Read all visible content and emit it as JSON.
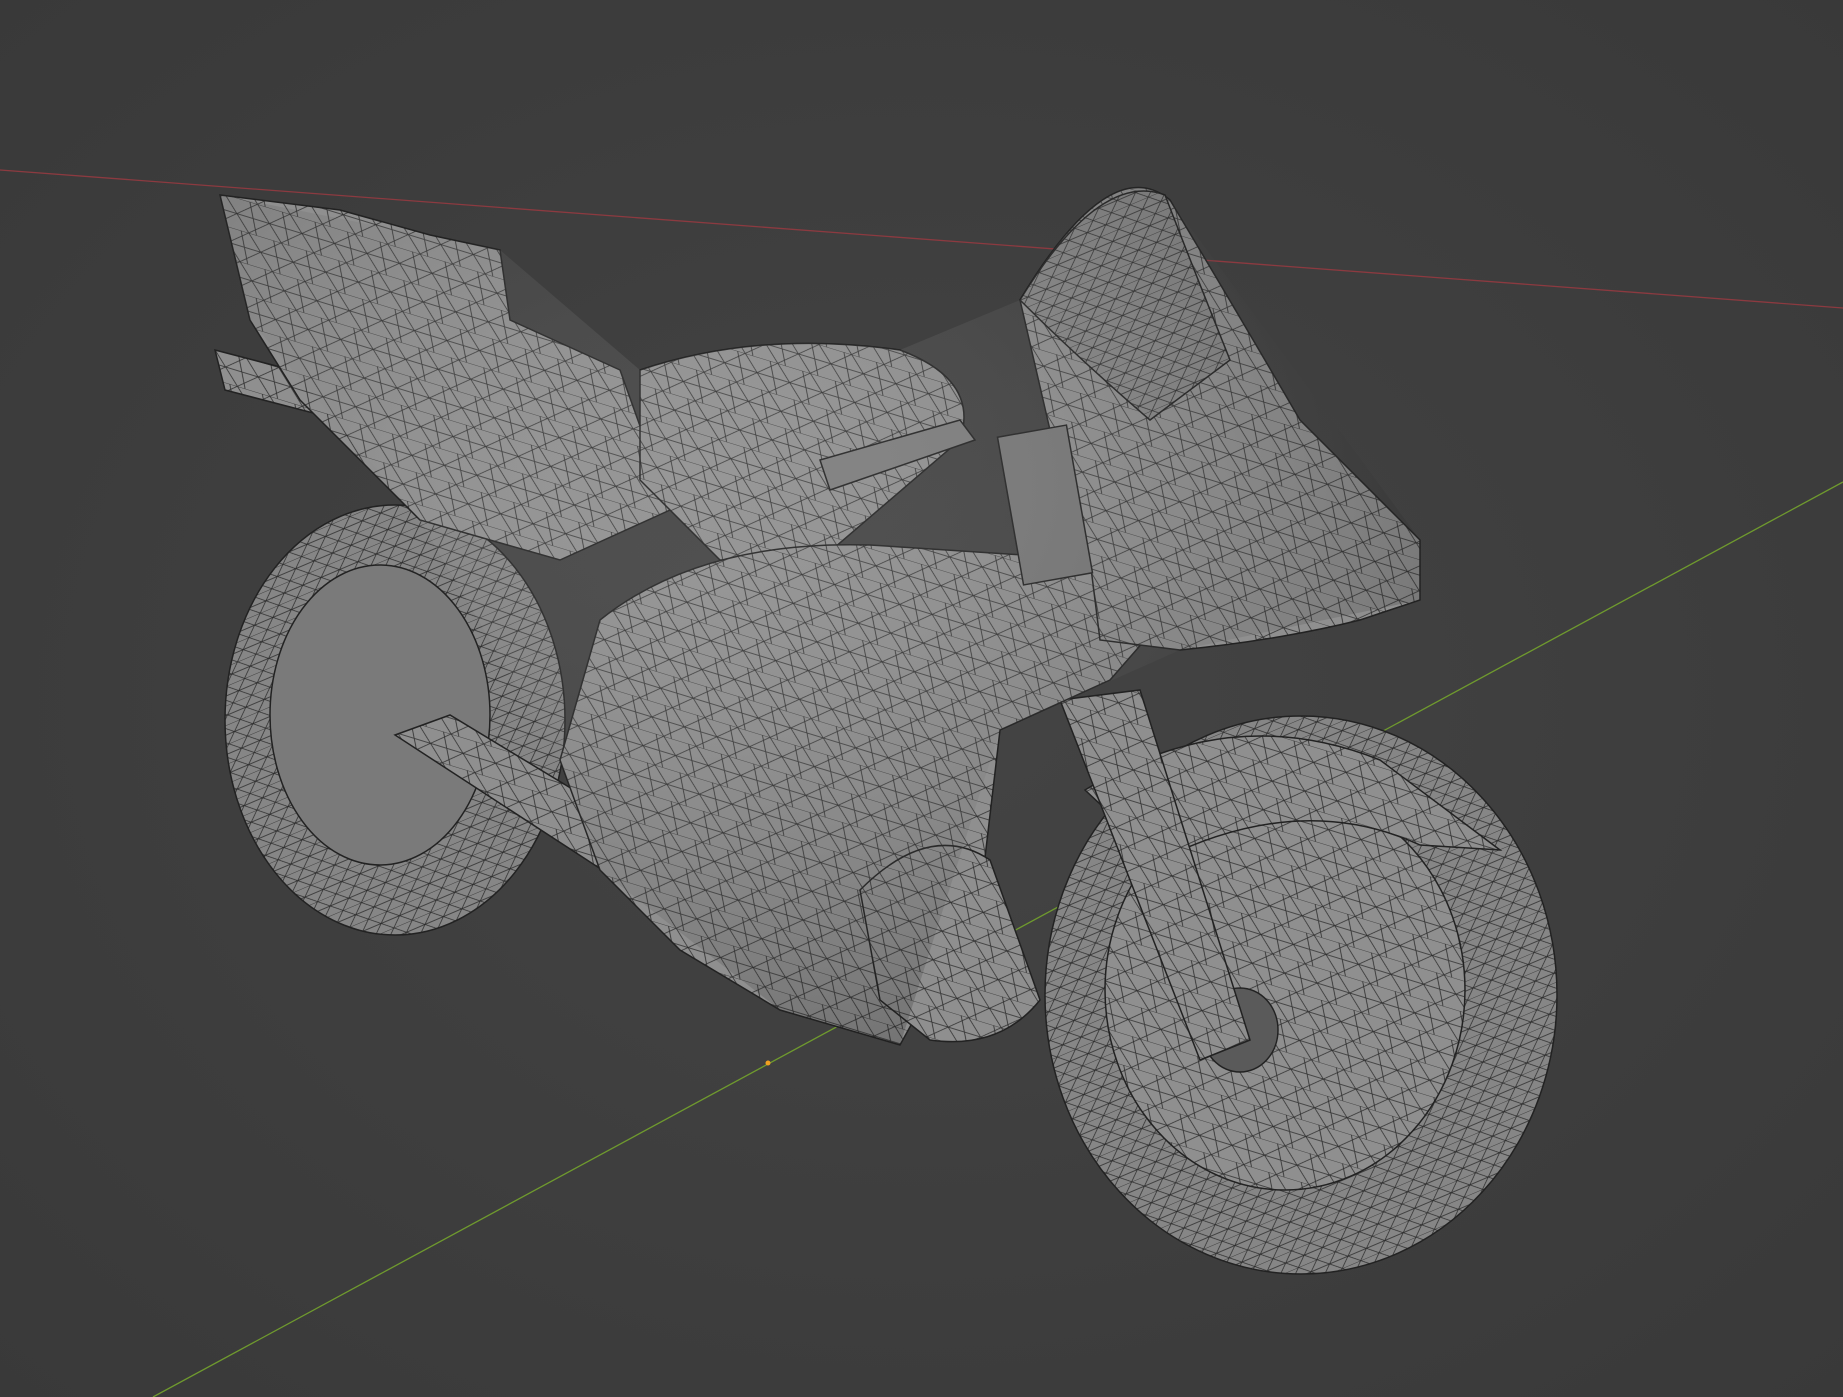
{
  "viewport": {
    "background": "#3d3d3d",
    "x_axis_color": "#8c3a40",
    "y_axis_color": "#6f9a2e",
    "origin_color": "#f0a020",
    "mesh_fill": "#8f8f8f",
    "mesh_wire": "#2a2a2a"
  }
}
